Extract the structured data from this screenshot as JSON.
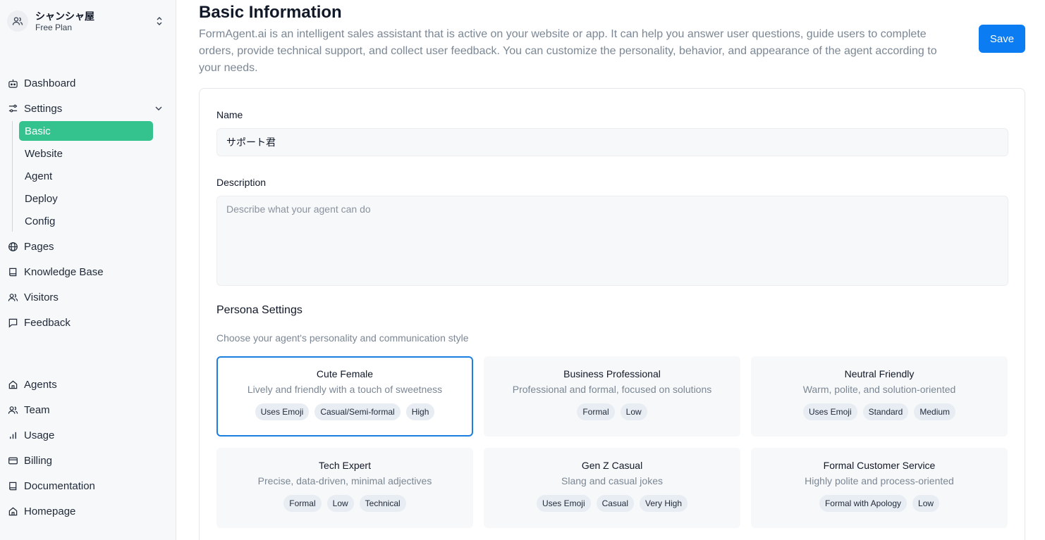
{
  "org": {
    "name": "シャンシャ屋",
    "plan": "Free Plan"
  },
  "nav": {
    "dashboard": "Dashboard",
    "settings": "Settings",
    "settings_sub": [
      "Basic",
      "Website",
      "Agent",
      "Deploy",
      "Config"
    ],
    "pages": "Pages",
    "knowledge_base": "Knowledge Base",
    "visitors": "Visitors",
    "feedback": "Feedback",
    "agents": "Agents",
    "team": "Team",
    "usage": "Usage",
    "billing": "Billing",
    "documentation": "Documentation",
    "homepage": "Homepage"
  },
  "header": {
    "title": "Basic Information",
    "description": "FormAgent.ai is an intelligent sales assistant that is active on your website or app. It can help you answer user questions, guide users to complete orders, provide technical support, and collect user feedback. You can customize the personality, behavior, and appearance of the agent according to your needs.",
    "save_label": "Save"
  },
  "form": {
    "name_label": "Name",
    "name_value": "サポート君",
    "description_label": "Description",
    "description_placeholder": "Describe what your agent can do",
    "persona_title": "Persona Settings",
    "persona_subtitle": "Choose your agent's personality and communication style"
  },
  "personas": [
    {
      "title": "Cute Female",
      "desc": "Lively and friendly with a touch of sweetness",
      "tags": [
        "Uses Emoji",
        "Casual/Semi-formal",
        "High"
      ],
      "selected": true
    },
    {
      "title": "Business Professional",
      "desc": "Professional and formal, focused on solutions",
      "tags": [
        "Formal",
        "Low"
      ],
      "selected": false
    },
    {
      "title": "Neutral Friendly",
      "desc": "Warm, polite, and solution-oriented",
      "tags": [
        "Uses Emoji",
        "Standard",
        "Medium"
      ],
      "selected": false
    },
    {
      "title": "Tech Expert",
      "desc": "Precise, data-driven, minimal adjectives",
      "tags": [
        "Formal",
        "Low",
        "Technical"
      ],
      "selected": false
    },
    {
      "title": "Gen Z Casual",
      "desc": "Slang and casual jokes",
      "tags": [
        "Uses Emoji",
        "Casual",
        "Very High"
      ],
      "selected": false
    },
    {
      "title": "Formal Customer Service",
      "desc": "Highly polite and process-oriented",
      "tags": [
        "Formal with Apology",
        "Low"
      ],
      "selected": false
    }
  ],
  "colors": {
    "accent_green": "#34c38f",
    "primary_blue": "#0b7cf2",
    "selected_border": "#1a7fe0"
  },
  "icons": [
    "users-icon",
    "chevron-updown-icon",
    "robot-icon",
    "sliders-icon",
    "chevron-down-icon",
    "globe-icon",
    "book-icon",
    "user-group-icon",
    "message-icon",
    "home-icon",
    "bar-chart-icon",
    "credit-card-icon"
  ]
}
